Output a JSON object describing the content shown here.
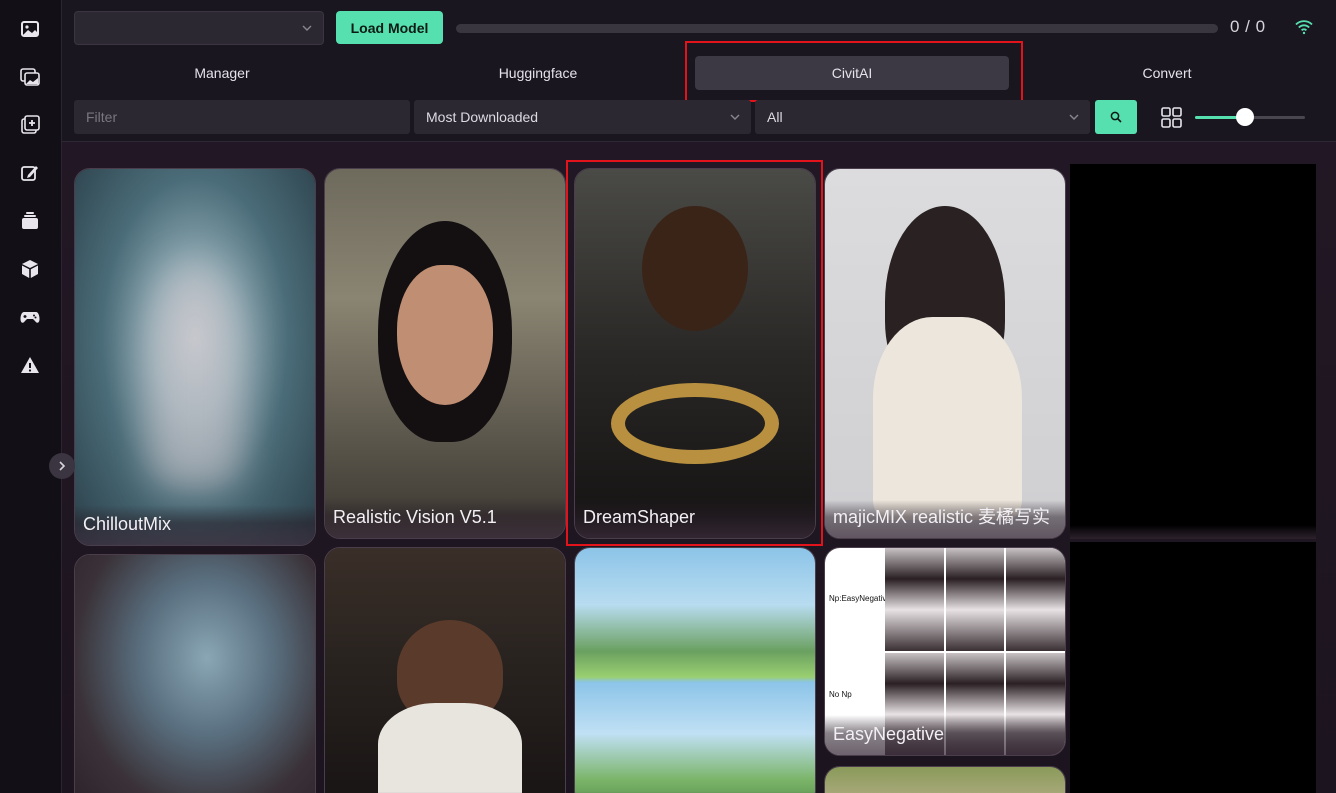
{
  "sidebar": {
    "icons": [
      {
        "name": "image-icon"
      },
      {
        "name": "gallery-icon"
      },
      {
        "name": "add-layer-icon"
      },
      {
        "name": "edit-icon"
      },
      {
        "name": "stack-icon"
      },
      {
        "name": "cube-icon"
      },
      {
        "name": "gamepad-icon"
      },
      {
        "name": "warning-icon"
      }
    ],
    "collapse": "chevron-right-icon"
  },
  "toolbar": {
    "model_select_value": "",
    "load_label": "Load Model",
    "progress_text": "0 / 0",
    "progress_fraction": 0,
    "status_icon": "wifi-icon"
  },
  "tabs": [
    {
      "label": "Manager",
      "active": false
    },
    {
      "label": "Huggingface",
      "active": false
    },
    {
      "label": "CivitAI",
      "active": true
    },
    {
      "label": "Convert",
      "active": false
    }
  ],
  "filters": {
    "filter_placeholder": "Filter",
    "sort_value": "Most Downloaded",
    "type_value": "All",
    "search_icon": "search-icon",
    "view_icon": "grid-view-icon",
    "size_slider_fraction": 0.45
  },
  "models": [
    {
      "name": "ChilloutMix"
    },
    {
      "name": "Realistic Vision V5.1"
    },
    {
      "name": "DreamShaper"
    },
    {
      "name": "majicMIX realistic 麦橘写实"
    },
    {
      "name": ""
    },
    {
      "name": ""
    },
    {
      "name": ""
    },
    {
      "name": ""
    },
    {
      "name": "EasyNegative"
    },
    {
      "name": ""
    }
  ],
  "easynegative_tags": {
    "top": "Np:EasyNegative",
    "bottom": "No Np"
  },
  "colors": {
    "accent": "#56e0b0",
    "highlight": "#e3131b",
    "background": "#16121a"
  }
}
